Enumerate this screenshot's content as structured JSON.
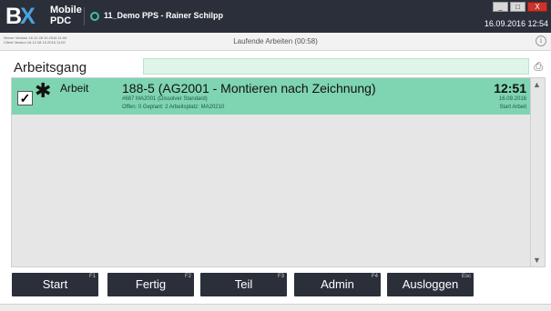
{
  "app": {
    "logo_b": "B",
    "logo_x": "X",
    "logo_line1": "Mobile",
    "logo_line2": "PDC",
    "title": "11_Demo PPS - Rainer Schilpp",
    "date_time": "16.09.2016 12:54",
    "window_buttons": {
      "minimize": "_",
      "maximize": "□",
      "close": "X"
    }
  },
  "infobar": {
    "server_version": "Server Version 16.12.28 10.2016 11:00",
    "client_version": "Client Version 16.12.28 10.2016 11:00",
    "status_text": "Laufende Arbeiten (00:58)",
    "info_icon": "i"
  },
  "section": {
    "title": "Arbeitsgang",
    "field_value": ""
  },
  "list": {
    "rows": [
      {
        "checked": "✓",
        "type": "Arbeit",
        "title": "188-5 (AG2001 - Montieren nach Zeichnung)",
        "sub1": "#687 MA2001 (Dissolver Standard)",
        "sub2": "Offen: 0 Geplant: 2 Arbeitsplatz: MA20210",
        "time": "12:51",
        "date": "16.09.2016",
        "status": "Start Arbeit"
      }
    ],
    "scroll_up": "▲",
    "scroll_down": "▼"
  },
  "buttons": [
    {
      "label": "Start",
      "corner": "F1"
    },
    {
      "label": "Fertig",
      "corner": "F2"
    },
    {
      "label": "Teil",
      "corner": "F3"
    },
    {
      "label": "Admin",
      "corner": "F4"
    },
    {
      "label": "Ausloggen",
      "corner": "Esc"
    }
  ],
  "colors": {
    "titlebar": "#2b2f3a",
    "accent_green": "#7fd4b1",
    "field_green": "#dff5ea",
    "logo_x_blue": "#4aa3df",
    "close_red": "#c9352d"
  }
}
